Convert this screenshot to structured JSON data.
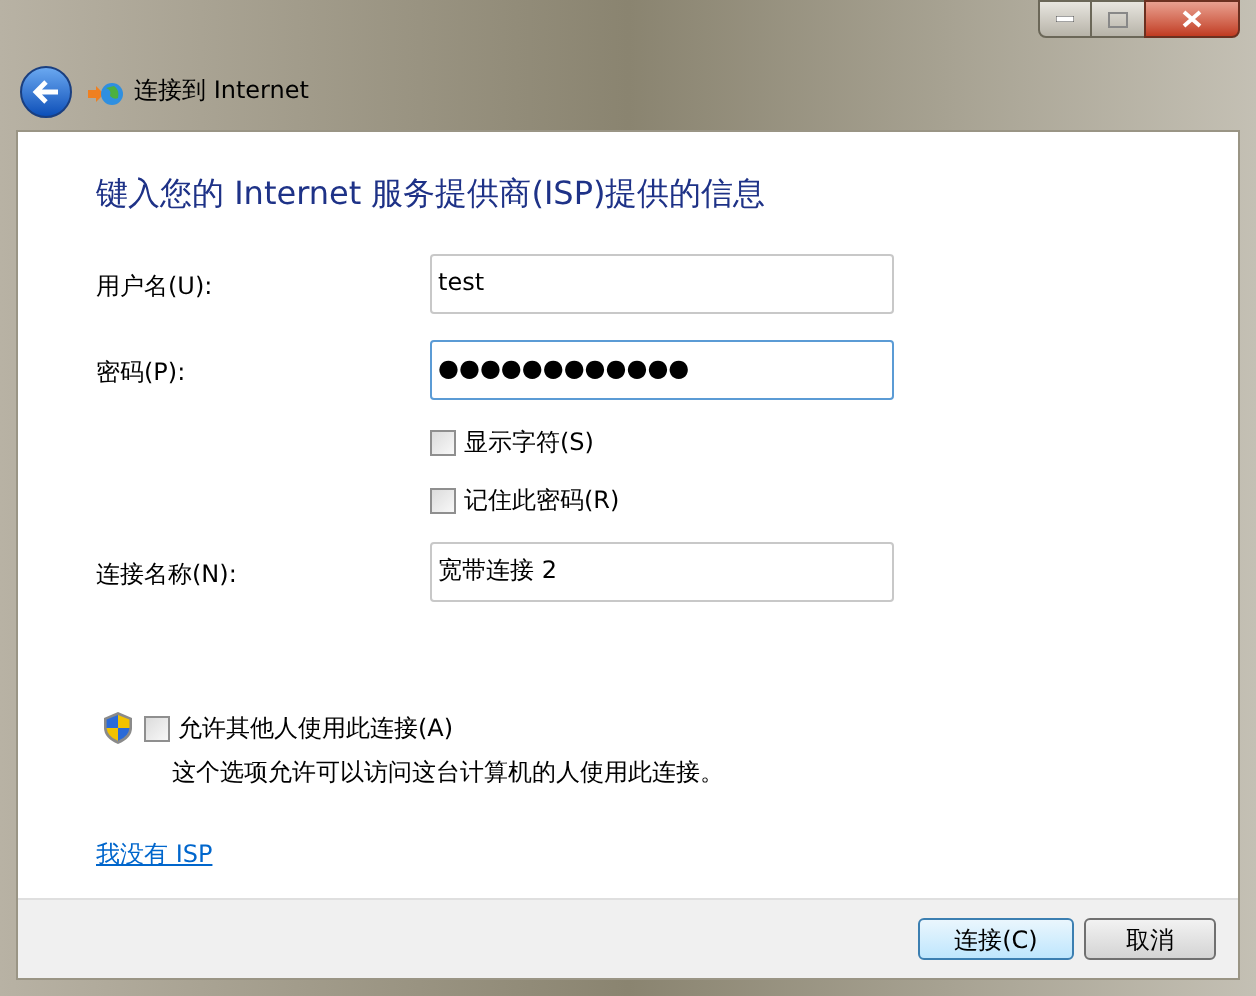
{
  "window": {
    "title": "连接到 Internet"
  },
  "heading": "键入您的 Internet 服务提供商(ISP)提供的信息",
  "fields": [
    {
      "label": "用户名(U):",
      "value": "test",
      "focused": false
    },
    {
      "label": "密码(P):",
      "value": "●●●●●●●●●●●●",
      "focused": true
    }
  ],
  "options": [
    {
      "label": "显示字符(S)",
      "checked": false
    },
    {
      "label": "记住此密码(R)",
      "checked": false
    }
  ],
  "connection_name": {
    "label": "连接名称(N):",
    "value": "宽带连接 2",
    "focused": false
  },
  "allow_others": {
    "label": "允许其他人使用此连接(A)",
    "checked": false,
    "description": "这个选项允许可以访问这台计算机的人使用此连接。"
  },
  "link": "我没有 ISP",
  "buttons": [
    {
      "label": "连接(C)",
      "default": true
    },
    {
      "label": "取消",
      "default": false
    }
  ]
}
